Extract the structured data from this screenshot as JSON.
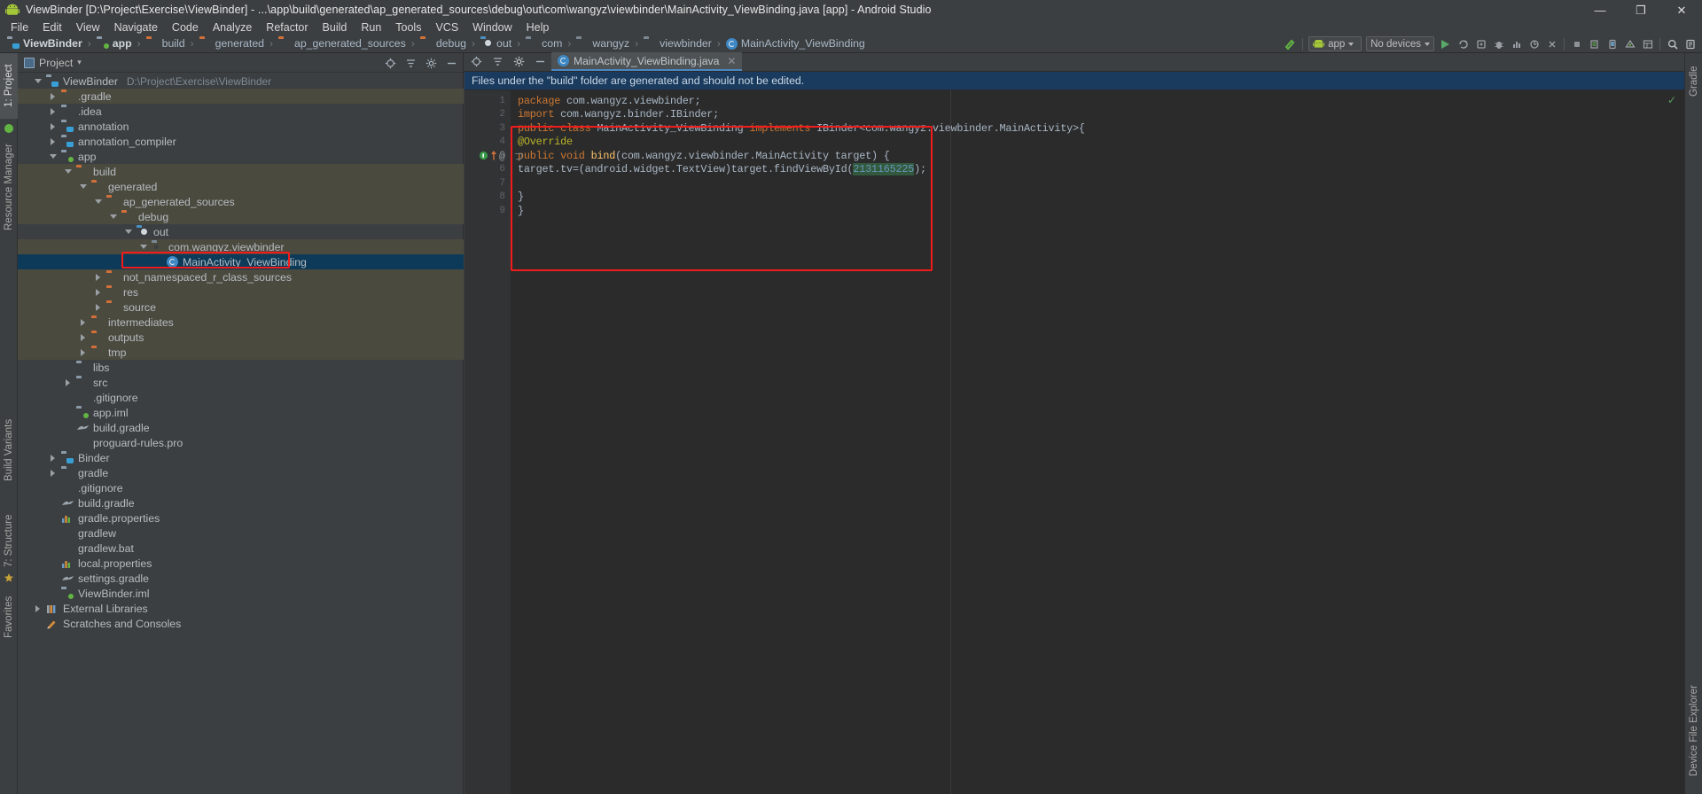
{
  "window": {
    "title": "ViewBinder [D:\\Project\\Exercise\\ViewBinder] - ...\\app\\build\\generated\\ap_generated_sources\\debug\\out\\com\\wangyz\\viewbinder\\MainActivity_ViewBinding.java [app] - Android Studio",
    "minimize": "—",
    "maximize": "❐",
    "close": "✕",
    "app_icon": "android-logo-icon"
  },
  "menu": {
    "items": [
      "File",
      "Edit",
      "View",
      "Navigate",
      "Code",
      "Analyze",
      "Refactor",
      "Build",
      "Run",
      "Tools",
      "VCS",
      "Window",
      "Help"
    ]
  },
  "breadcrumb": {
    "separator": "›",
    "items": [
      {
        "label": "ViewBinder",
        "icon": "module-folder-icon",
        "kind": "java",
        "bold": true
      },
      {
        "label": "app",
        "icon": "module-folder-icon",
        "kind": "module",
        "bold": true
      },
      {
        "label": "build",
        "icon": "folder-icon",
        "kind": "orange",
        "bold": false
      },
      {
        "label": "generated",
        "icon": "folder-icon",
        "kind": "orange",
        "bold": false
      },
      {
        "label": "ap_generated_sources",
        "icon": "folder-icon",
        "kind": "orange",
        "bold": false
      },
      {
        "label": "debug",
        "icon": "folder-icon",
        "kind": "orange",
        "bold": false
      },
      {
        "label": "out",
        "icon": "generated-folder-icon",
        "kind": "gen",
        "bold": false
      },
      {
        "label": "com",
        "icon": "package-icon",
        "kind": "pkg",
        "bold": false
      },
      {
        "label": "wangyz",
        "icon": "package-icon",
        "kind": "pkg",
        "bold": false
      },
      {
        "label": "viewbinder",
        "icon": "package-icon",
        "kind": "pkg",
        "bold": false
      },
      {
        "label": "MainActivity_ViewBinding",
        "icon": "class-icon",
        "kind": "class",
        "bold": false
      }
    ]
  },
  "toolbar": {
    "build_icon": "hammer-icon",
    "module_selector": {
      "label": "app",
      "icon": "android-icon",
      "caret": "▾"
    },
    "device_selector": {
      "label": "No devices",
      "caret": "▾"
    },
    "run_icon": "run-play-icon",
    "rerun_icon": "rerun-icon",
    "apply_changes_icon": "apply-changes-icon",
    "debug_icon": "debug-bug-icon",
    "profile_icon": "profile-icon",
    "attach_icon": "attach-debugger-icon",
    "stop_icon": "stop-icon",
    "avd_icon": "avd-manager-icon",
    "sdk_icon": "sdk-manager-icon",
    "layout_inspector_icon": "layout-inspector-icon",
    "sync_icon": "gradle-sync-icon",
    "search_icon": "search-icon",
    "settings_icon": "settings-icon"
  },
  "left_tool_strip": {
    "tabs": [
      {
        "label": "1: Project",
        "active": true,
        "icon": "project-icon"
      },
      {
        "label": "Resource Manager",
        "active": false,
        "icon": "resource-icon"
      },
      {
        "label": "Build Variants",
        "active": false,
        "icon": "build-variants-icon"
      },
      {
        "label": "7: Structure",
        "active": false,
        "icon": "structure-icon"
      },
      {
        "label": "Favorites",
        "active": false,
        "icon": "star-icon"
      }
    ]
  },
  "project_panel": {
    "header": {
      "title": "Project",
      "caret": "▾",
      "icon": "project-view-icon"
    },
    "actions": [
      {
        "name": "locate-icon",
        "glyph": "⊕"
      },
      {
        "name": "collapse-all-icon",
        "glyph": "≡"
      },
      {
        "name": "settings-gear-icon",
        "glyph": "⚙"
      },
      {
        "name": "hide-panel-icon",
        "glyph": "—"
      }
    ],
    "tree": [
      {
        "label": "ViewBinder",
        "path": "D:\\Project\\Exercise\\ViewBinder",
        "indent": 0,
        "twisty": "down",
        "icon": "java-folder-icon",
        "alt": false,
        "selected": false
      },
      {
        "label": ".gradle",
        "indent": 1,
        "twisty": "right",
        "icon": "orange-folder-icon",
        "alt": true,
        "selected": false
      },
      {
        "label": ".idea",
        "indent": 1,
        "twisty": "right",
        "icon": "grey-folder-icon",
        "alt": false,
        "selected": false
      },
      {
        "label": "annotation",
        "indent": 1,
        "twisty": "right",
        "icon": "java-folder-icon",
        "alt": false,
        "selected": false
      },
      {
        "label": "annotation_compiler",
        "indent": 1,
        "twisty": "right",
        "icon": "java-folder-icon",
        "alt": false,
        "selected": false
      },
      {
        "label": "app",
        "indent": 1,
        "twisty": "down",
        "icon": "module-folder-icon",
        "alt": false,
        "selected": false
      },
      {
        "label": "build",
        "indent": 2,
        "twisty": "down",
        "icon": "orange-folder-icon",
        "alt": true,
        "selected": false
      },
      {
        "label": "generated",
        "indent": 3,
        "twisty": "down",
        "icon": "orange-folder-icon",
        "alt": true,
        "selected": false
      },
      {
        "label": "ap_generated_sources",
        "indent": 4,
        "twisty": "down",
        "icon": "orange-folder-icon",
        "alt": true,
        "selected": false
      },
      {
        "label": "debug",
        "indent": 5,
        "twisty": "down",
        "icon": "orange-folder-icon",
        "alt": true,
        "selected": false
      },
      {
        "label": "out",
        "indent": 6,
        "twisty": "down",
        "icon": "generated-folder-icon",
        "alt": false,
        "selected": false
      },
      {
        "label": "com.wangyz.viewbinder",
        "indent": 7,
        "twisty": "down",
        "icon": "package-icon",
        "alt": true,
        "selected": false
      },
      {
        "label": "MainActivity_ViewBinding",
        "indent": 8,
        "twisty": "none",
        "icon": "class-icon",
        "alt": false,
        "selected": true
      },
      {
        "label": "not_namespaced_r_class_sources",
        "indent": 4,
        "twisty": "right",
        "icon": "orange-folder-icon",
        "alt": true,
        "selected": false
      },
      {
        "label": "res",
        "indent": 4,
        "twisty": "right",
        "icon": "orange-folder-icon",
        "alt": true,
        "selected": false
      },
      {
        "label": "source",
        "indent": 4,
        "twisty": "right",
        "icon": "orange-folder-icon",
        "alt": true,
        "selected": false
      },
      {
        "label": "intermediates",
        "indent": 3,
        "twisty": "right",
        "icon": "orange-folder-icon",
        "alt": true,
        "selected": false
      },
      {
        "label": "outputs",
        "indent": 3,
        "twisty": "right",
        "icon": "orange-folder-icon",
        "alt": true,
        "selected": false
      },
      {
        "label": "tmp",
        "indent": 3,
        "twisty": "right",
        "icon": "orange-folder-icon",
        "alt": true,
        "selected": false
      },
      {
        "label": "libs",
        "indent": 2,
        "twisty": "none",
        "icon": "grey-folder-icon",
        "alt": false,
        "selected": false
      },
      {
        "label": "src",
        "indent": 2,
        "twisty": "right",
        "icon": "grey-folder-icon",
        "alt": false,
        "selected": false
      },
      {
        "label": ".gitignore",
        "indent": 2,
        "twisty": "none",
        "icon": "file-icon",
        "alt": false,
        "selected": false
      },
      {
        "label": "app.iml",
        "indent": 2,
        "twisty": "none",
        "icon": "module-folder-icon",
        "alt": false,
        "selected": false
      },
      {
        "label": "build.gradle",
        "indent": 2,
        "twisty": "none",
        "icon": "gradle-icon",
        "alt": false,
        "selected": false
      },
      {
        "label": "proguard-rules.pro",
        "indent": 2,
        "twisty": "none",
        "icon": "file-icon",
        "alt": false,
        "selected": false
      },
      {
        "label": "Binder",
        "indent": 1,
        "twisty": "right",
        "icon": "java-folder-icon",
        "alt": false,
        "selected": false
      },
      {
        "label": "gradle",
        "indent": 1,
        "twisty": "right",
        "icon": "grey-folder-icon",
        "alt": false,
        "selected": false
      },
      {
        "label": ".gitignore",
        "indent": 1,
        "twisty": "none",
        "icon": "file-icon",
        "alt": false,
        "selected": false
      },
      {
        "label": "build.gradle",
        "indent": 1,
        "twisty": "none",
        "icon": "gradle-icon",
        "alt": false,
        "selected": false
      },
      {
        "label": "gradle.properties",
        "indent": 1,
        "twisty": "none",
        "icon": "properties-icon",
        "alt": false,
        "selected": false
      },
      {
        "label": "gradlew",
        "indent": 1,
        "twisty": "none",
        "icon": "file-icon",
        "alt": false,
        "selected": false
      },
      {
        "label": "gradlew.bat",
        "indent": 1,
        "twisty": "none",
        "icon": "file-icon",
        "alt": false,
        "selected": false
      },
      {
        "label": "local.properties",
        "indent": 1,
        "twisty": "none",
        "icon": "properties-icon",
        "alt": false,
        "selected": false
      },
      {
        "label": "settings.gradle",
        "indent": 1,
        "twisty": "none",
        "icon": "gradle-icon",
        "alt": false,
        "selected": false
      },
      {
        "label": "ViewBinder.iml",
        "indent": 1,
        "twisty": "none",
        "icon": "module-folder-icon",
        "alt": false,
        "selected": false
      },
      {
        "label": "External Libraries",
        "indent": 0,
        "twisty": "right",
        "icon": "libraries-icon",
        "alt": false,
        "selected": false
      },
      {
        "label": "Scratches and Consoles",
        "indent": 0,
        "twisty": "none",
        "icon": "scratches-icon",
        "alt": false,
        "selected": false
      }
    ]
  },
  "editor": {
    "tab": {
      "label": "MainActivity_ViewBinding.java",
      "icon": "class-icon",
      "close": "✕"
    },
    "tab_actions": [
      {
        "name": "locate-file-icon",
        "glyph": "⊕"
      },
      {
        "name": "collapse-icon",
        "glyph": "≡"
      },
      {
        "name": "settings-gear-icon",
        "glyph": "⚙"
      },
      {
        "name": "hide-panel-icon",
        "glyph": "—"
      }
    ],
    "notification": "Files under the \"build\" folder are generated and should not be edited.",
    "inspection_ok": "✓",
    "gutter_markers": {
      "line": 5,
      "implements_marker": "⇧",
      "annotation_marker": "@",
      "fold_marker": "⊟"
    },
    "lines": [
      {
        "no": 1,
        "tokens": [
          {
            "t": "package",
            "c": "kw"
          },
          {
            "t": " com.wangyz.viewbinder;",
            "c": "pl"
          }
        ]
      },
      {
        "no": 2,
        "tokens": [
          {
            "t": "import",
            "c": "kw"
          },
          {
            "t": " com.wangyz.binder.IBinder;",
            "c": "pl"
          }
        ]
      },
      {
        "no": 3,
        "tokens": [
          {
            "t": "public class",
            "c": "kw"
          },
          {
            "t": " MainActivity_ViewBinding ",
            "c": "pl"
          },
          {
            "t": "implements",
            "c": "kw"
          },
          {
            "t": " IBinder<com.wangyz.viewbinder.MainActivity>{",
            "c": "pl"
          }
        ]
      },
      {
        "no": 4,
        "tokens": [
          {
            "t": "@Override",
            "c": "anno"
          }
        ]
      },
      {
        "no": 5,
        "tokens": [
          {
            "t": "public void ",
            "c": "kw"
          },
          {
            "t": "bind",
            "c": "fn"
          },
          {
            "t": "(com.wangyz.viewbinder.MainActivity target) {",
            "c": "pl"
          }
        ]
      },
      {
        "no": 6,
        "tokens": [
          {
            "t": "target.tv=(android.widget.TextView)target.findViewById(",
            "c": "pl"
          },
          {
            "t": "2131165225",
            "c": "num"
          },
          {
            "t": ");",
            "c": "pl"
          }
        ]
      },
      {
        "no": 7,
        "tokens": []
      },
      {
        "no": 8,
        "tokens": [
          {
            "t": "}",
            "c": "pl"
          }
        ]
      },
      {
        "no": 9,
        "tokens": [
          {
            "t": "}",
            "c": "pl"
          }
        ]
      }
    ]
  },
  "right_tool_strip": {
    "tabs": [
      {
        "label": "Gradle",
        "active": false,
        "icon": "gradle-icon"
      },
      {
        "label": "Device File Explorer",
        "active": false,
        "icon": "device-explorer-icon"
      }
    ]
  },
  "annotations": {
    "highlight_color": "#f21b1b",
    "boxes": [
      {
        "name": "tree-selected-file-highlight"
      },
      {
        "name": "code-block-highlight"
      }
    ]
  }
}
